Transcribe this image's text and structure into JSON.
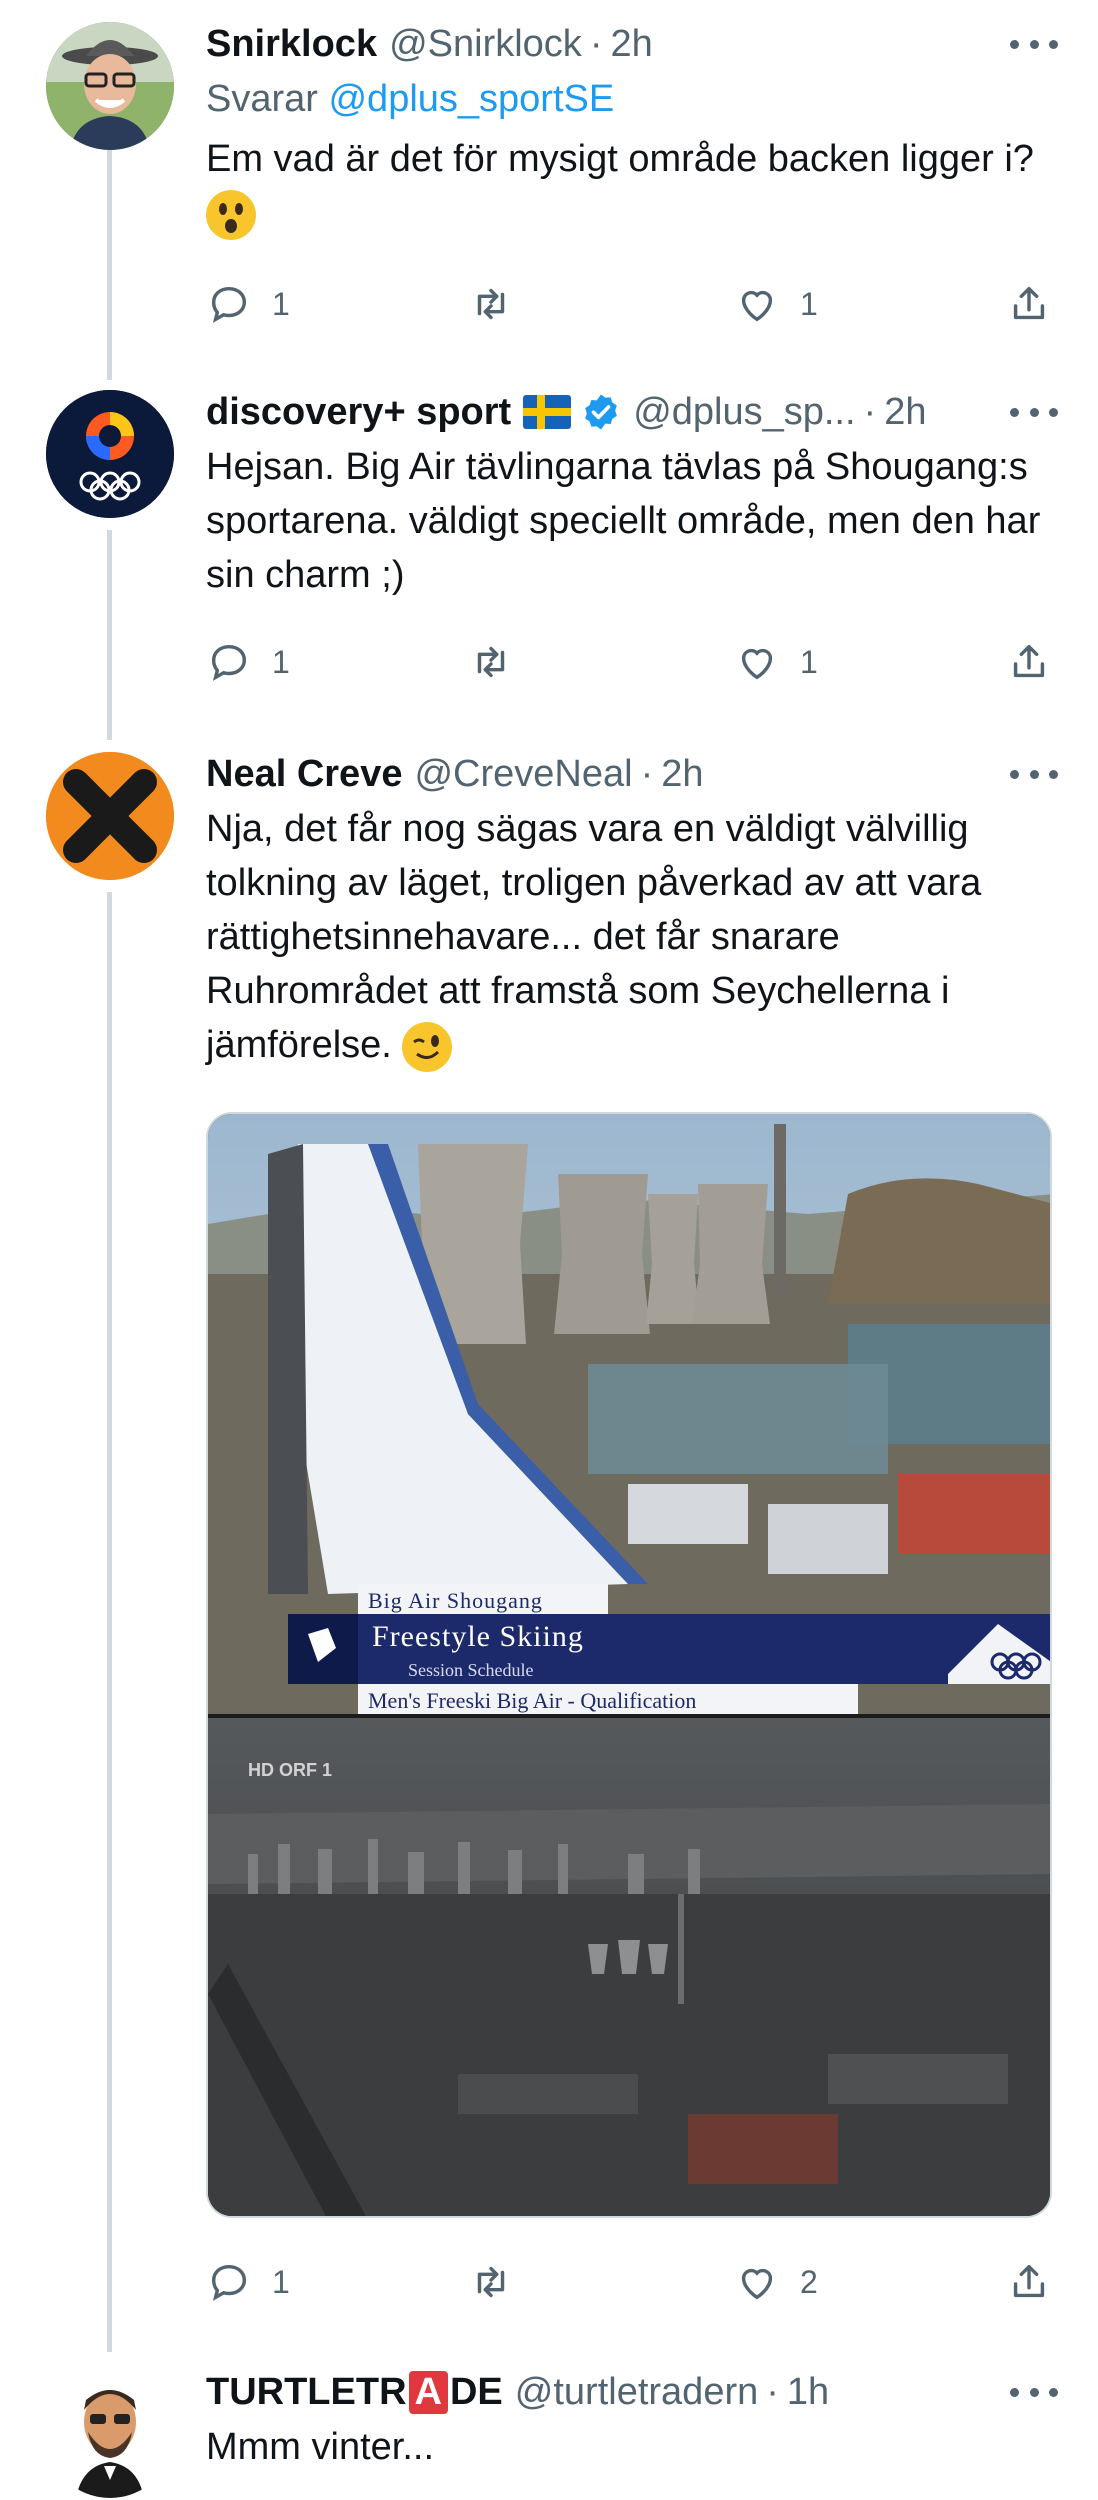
{
  "tweets": [
    {
      "name": "Snirklock",
      "handle": "@Snirklock",
      "time": "2h",
      "replying_prefix": "Svarar",
      "replying_to": "@dplus_sportSE",
      "text": "Em vad är det för mysigt område backen ligger i?",
      "emoji": "astonished-face-emoji",
      "replies": "1",
      "retweets": "",
      "likes": "1"
    },
    {
      "name": "discovery+ sport",
      "handle": "@dplus_sp...",
      "time": "2h",
      "text": "Hejsan. Big Air tävlingarna tävlas på Shougang:s sportarena. väldigt speciellt område, men den har sin charm ;)",
      "replies": "1",
      "retweets": "",
      "likes": "1"
    },
    {
      "name": "Neal Creve",
      "handle": "@CreveNeal",
      "time": "2h",
      "text": "Nja, det får nog sägas vara en väldigt välvillig tolkning av läget, troligen påverkad av att vara rättighetsinnehavare... det får snarare Ruhrområdet att framstå som Seychellerna i jämförelse.",
      "emoji": "winking-face-emoji",
      "replies": "1",
      "retweets": "",
      "likes": "2"
    },
    {
      "name_part1": "TURTLETR",
      "name_badge": "A",
      "name_part2": "DE",
      "handle": "@turtletradern",
      "time": "1h",
      "text": "Mmm vinter..."
    }
  ],
  "media": {
    "broadcast_overlay": {
      "venue": "Big Air Shougang",
      "sport": "Freestyle Skiing",
      "subtitle": "Session Schedule",
      "event": "Men's Freeski Big Air - Qualification"
    },
    "channel_bug": "HD ORF 1"
  },
  "colors": {
    "accent_blue": "#1d9bf0",
    "secondary_text": "#536471",
    "thread_line": "#cfd9de",
    "overlay_navy": "#1c2a6b",
    "verified": "#1d9bf0"
  }
}
